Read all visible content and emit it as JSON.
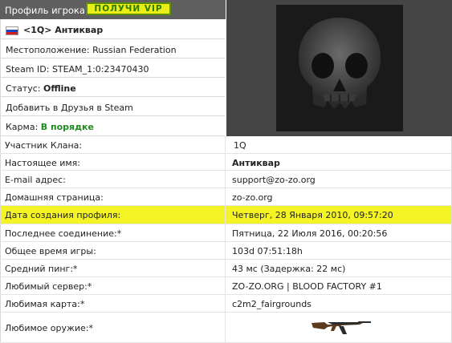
{
  "header": {
    "title": "Профиль игрока",
    "vip_button": "ПОЛУЧИ VIP"
  },
  "player": {
    "name": "<1Q> Антиквар",
    "location_label": "Местоположение:",
    "location": "Russian Federation",
    "steam_label": "Steam ID:",
    "steam_id": "STEAM_1:0:23470430",
    "status_label": "Статус:",
    "status": "Offline",
    "add_friend": "Добавить в Друзья в Steam",
    "karma_label": "Карма:",
    "karma": "В порядке"
  },
  "details": [
    {
      "k": "Участник Клана:",
      "v": "1Q"
    },
    {
      "k": "Настоящее имя:",
      "v": "Антиквар"
    },
    {
      "k": "E-mail адрес:",
      "v": "support@zo-zo.org"
    },
    {
      "k": "Домашняя страница:",
      "v": "zo-zo.org"
    },
    {
      "k": "Дата создания профиля:",
      "v": "Четверг, 28 Января 2010, 09:57:20"
    },
    {
      "k": "Последнее соединение:*",
      "v": "Пятница, 22 Июля 2016, 00:20:56"
    },
    {
      "k": "Общее время игры:",
      "v": "103d 07:51:18h"
    },
    {
      "k": "Средний пинг:*",
      "v": "43 мс (Задержка: 22 мс)"
    },
    {
      "k": "Любимый сервер:*",
      "v": "ZO-ZO.ORG | BLOOD FACTORY #1"
    },
    {
      "k": "Любимая карта:*",
      "v": "c2m2_fairgrounds"
    },
    {
      "k": "Любимое оружие:*",
      "v": ""
    }
  ],
  "icons": {
    "flag": "russia-flag-icon",
    "avatar": "skull-avatar",
    "weapon": "ak47-weapon-icon"
  },
  "colors": {
    "highlight": "#f3f325",
    "vip_bg": "#e8ee16",
    "karma": "#1f8a1f"
  }
}
